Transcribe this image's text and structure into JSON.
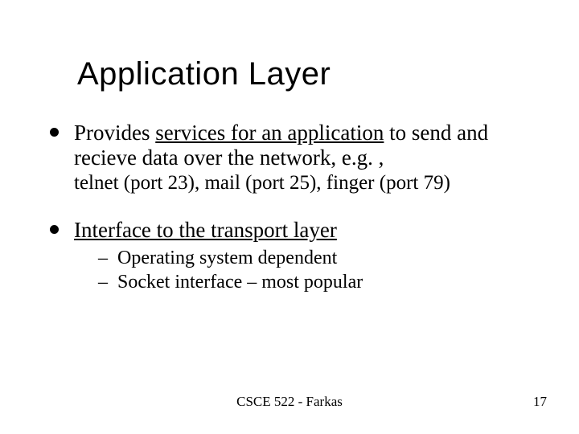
{
  "title": "Application Layer",
  "bullets": [
    {
      "pre": "Provides ",
      "underlined": "services for an application",
      "post": " to send and recieve data over the network, e.g. ,",
      "sub": "telnet  (port 23), mail  (port 25), finger (port 79)"
    },
    {
      "pre": "",
      "underlined": "Interface to the transport layer",
      "post": "",
      "children": [
        "Operating system dependent",
        "Socket interface – most popular"
      ]
    }
  ],
  "footer": {
    "center": "CSCE 522 - Farkas",
    "page": "17"
  }
}
